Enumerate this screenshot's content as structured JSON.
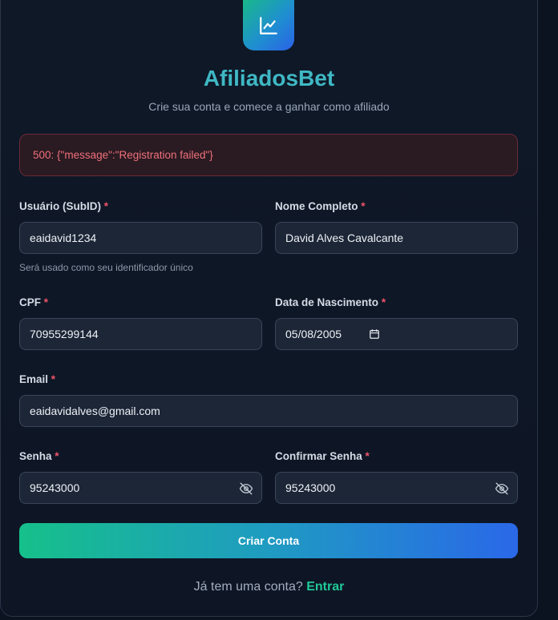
{
  "brand": {
    "title": "AfiliadosBet",
    "subtitle": "Crie sua conta e comece a ganhar como afiliado",
    "logo_icon": "line-chart-icon"
  },
  "alert": {
    "message": "500: {\"message\":\"Registration failed\"}"
  },
  "form": {
    "username": {
      "label": "Usuário (SubID)",
      "required": "*",
      "value": "eaidavid1234",
      "hint": "Será usado como seu identificador único"
    },
    "fullname": {
      "label": "Nome Completo",
      "required": "*",
      "value": "David Alves Cavalcante"
    },
    "cpf": {
      "label": "CPF",
      "required": "*",
      "value": "70955299144"
    },
    "birthdate": {
      "label": "Data de Nascimento",
      "required": "*",
      "value": "05/08/2005",
      "icon": "calendar-icon"
    },
    "email": {
      "label": "Email",
      "required": "*",
      "value": "eaidavidalves@gmail.com"
    },
    "password": {
      "label": "Senha",
      "required": "*",
      "value": "95243000",
      "icon": "eye-off-icon"
    },
    "confirm_password": {
      "label": "Confirmar Senha",
      "required": "*",
      "value": "95243000",
      "icon": "eye-off-icon"
    }
  },
  "submit": {
    "label": "Criar Conta"
  },
  "footer": {
    "prompt": "Já tem uma conta?",
    "link": "Entrar"
  },
  "colors": {
    "accent_green": "#20c997",
    "accent_blue": "#2a68e8",
    "error": "#f0707a",
    "required": "#f05468"
  }
}
